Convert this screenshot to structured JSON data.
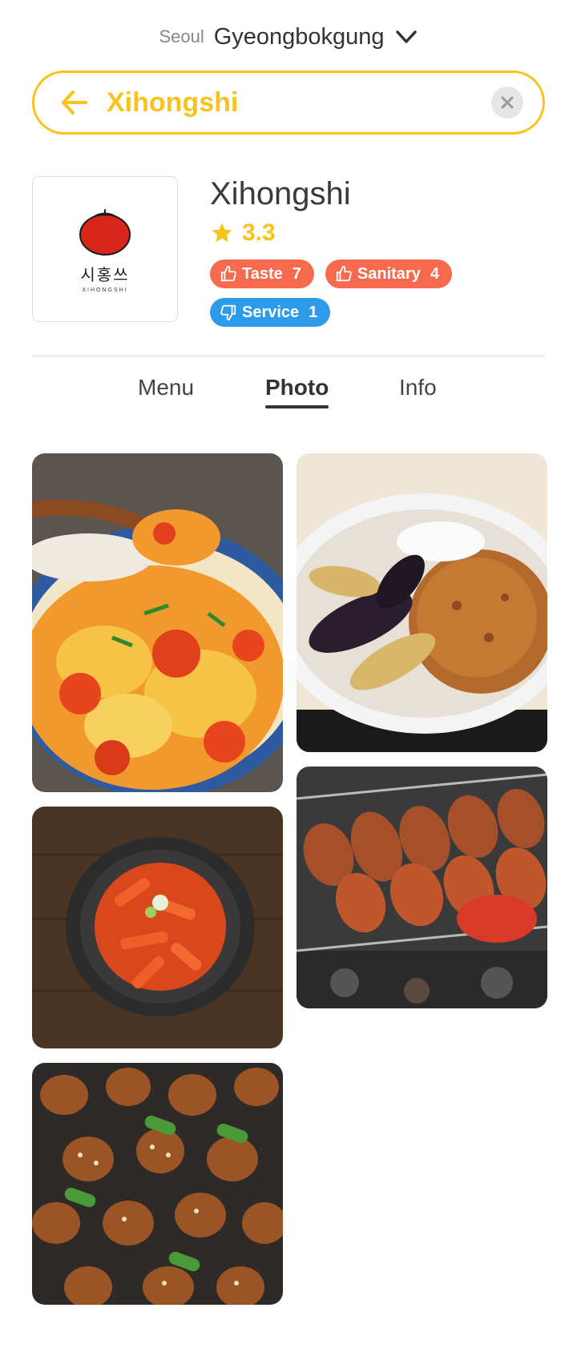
{
  "location": {
    "city": "Seoul",
    "district": "Gyeongbokgung"
  },
  "search": {
    "query": "Xihongshi"
  },
  "restaurant": {
    "name": "Xihongshi",
    "rating": "3.3",
    "logo": {
      "korean": "시홍쓰",
      "english": "XIHONGSHI"
    },
    "badges": [
      {
        "label": "Taste",
        "count": "7",
        "type": "thumbs-up"
      },
      {
        "label": "Sanitary",
        "count": "4",
        "type": "thumbs-up"
      },
      {
        "label": "Service",
        "count": "1",
        "type": "thumbs-down"
      }
    ]
  },
  "tabs": [
    {
      "label": "Menu",
      "active": false
    },
    {
      "label": "Photo",
      "active": true
    },
    {
      "label": "Info",
      "active": false
    }
  ],
  "photos": [
    {
      "subject": "tomato-egg-rice"
    },
    {
      "subject": "eggplant-minced-meat-rice-bowl"
    },
    {
      "subject": "tteokbokki"
    },
    {
      "subject": "grilled-skewers"
    },
    {
      "subject": "chicken-scallion-skewers"
    }
  ],
  "colors": {
    "accent": "#F9C31B",
    "positive": "#F76A4E",
    "negative": "#2E9BEA"
  }
}
